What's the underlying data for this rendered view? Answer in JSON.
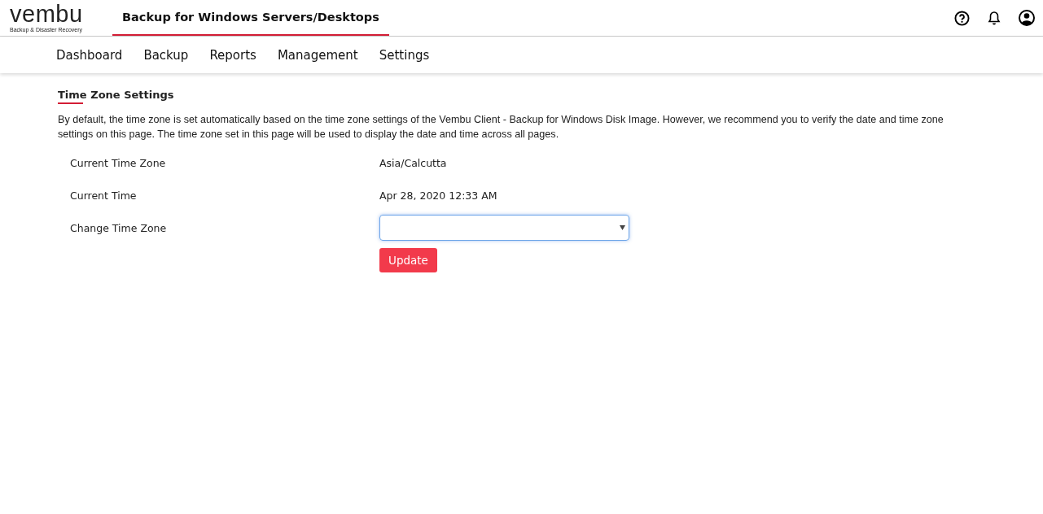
{
  "logo": {
    "name": "vembu",
    "tagline": "Backup & Disaster Recovery"
  },
  "product_tabs": [
    {
      "label": "Backup for Windows Servers/Desktops",
      "selected": true
    }
  ],
  "nav": [
    {
      "label": "Dashboard",
      "selected": false
    },
    {
      "label": "Backup",
      "selected": false
    },
    {
      "label": "Reports",
      "selected": false
    },
    {
      "label": "Management",
      "selected": false
    },
    {
      "label": "Settings",
      "selected": false
    }
  ],
  "section": {
    "title": "Time Zone Settings",
    "description": "By default, the time zone is set automatically based on the time zone settings of the Vembu Client - Backup for Windows Disk Image. However, we recommend you to verify the date and time zone settings on this page. The time zone set in this page will be used to display the date and time across all pages."
  },
  "fields": [
    {
      "kind": "text",
      "label": "Current Time Zone",
      "value": "Asia/Calcutta"
    },
    {
      "kind": "text",
      "label": "Current Time",
      "value": "Apr 28, 2020 12:33 AM"
    },
    {
      "kind": "select",
      "label": "Change Time Zone",
      "focused": true
    }
  ],
  "button": "Update"
}
